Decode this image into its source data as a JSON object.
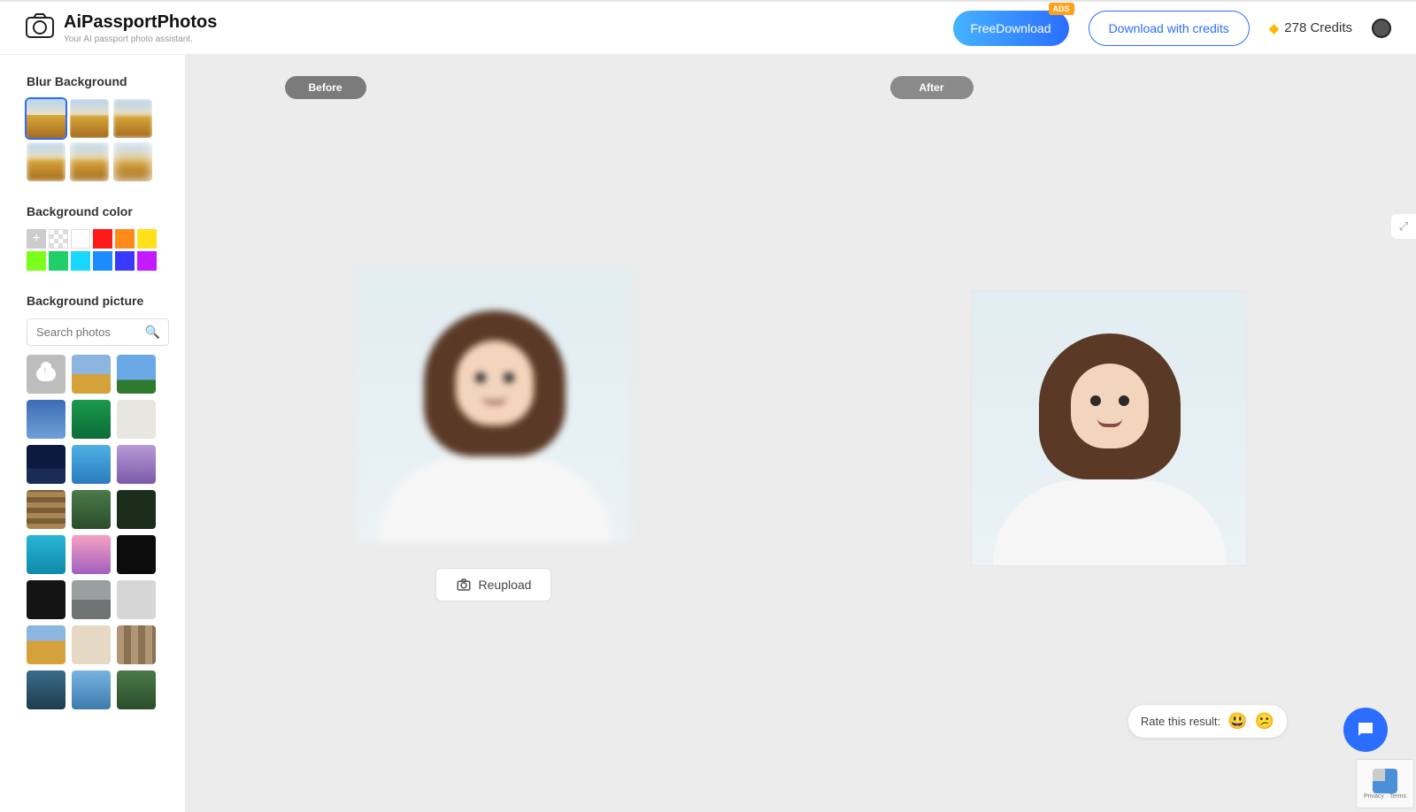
{
  "brand": {
    "title": "AiPassportPhotos",
    "subtitle": "Your AI passport photo assistant."
  },
  "header": {
    "free_download": "FreeDownload",
    "ads_tag": "ADS",
    "download_credits": "Download with credits",
    "credits_label": "278 Credits"
  },
  "sidebar": {
    "blur_heading": "Blur Background",
    "colors_heading": "Background color",
    "colors": [
      "#cccccc",
      "transparent",
      "#ffffff",
      "#ff1a1a",
      "#ff8a1a",
      "#ffe01a",
      "#7bff1a",
      "#1ecf6a",
      "#1ad7ff",
      "#1a8cff",
      "#3a3aff",
      "#c31aff"
    ],
    "picture_heading": "Background picture",
    "search_placeholder": "Search photos"
  },
  "editor": {
    "before_label": "Before",
    "after_label": "After",
    "reupload_label": "Reupload"
  },
  "rate": {
    "text": "Rate this result:"
  },
  "captcha": {
    "line1": "Privacy · Terms"
  }
}
